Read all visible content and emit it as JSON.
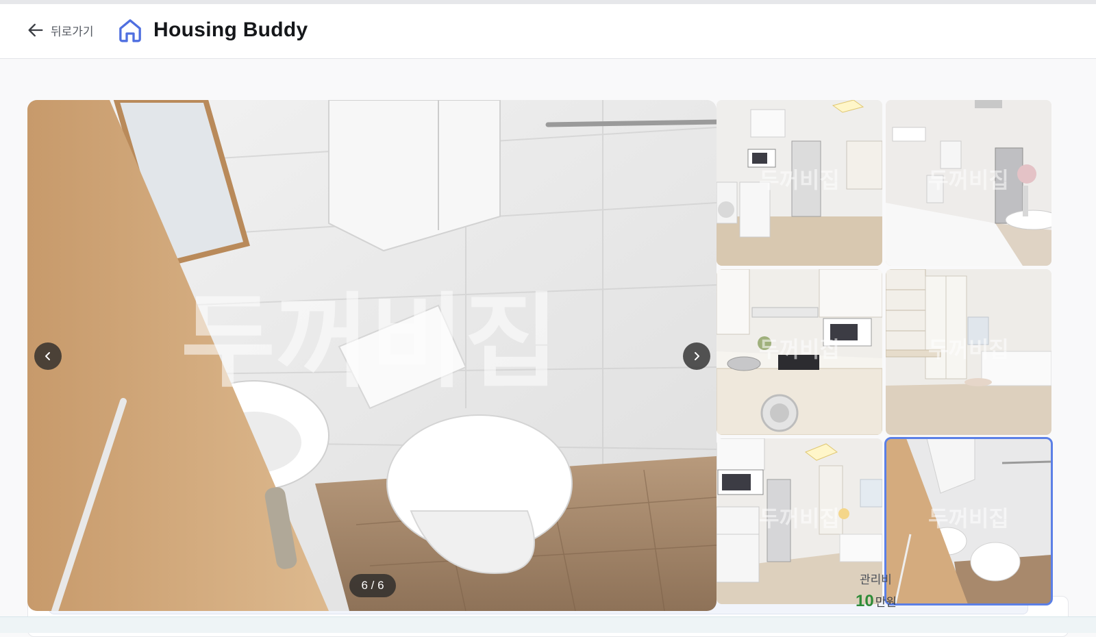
{
  "header": {
    "back_label": "뒤로가기",
    "title": "Housing Buddy",
    "brand_color": "#4f6fe0"
  },
  "gallery": {
    "counter": "6 / 6",
    "watermark": "두꺼비집",
    "current_index": 6,
    "total": 6,
    "thumbnails": [
      {
        "name": "kitchen-entrance",
        "watermark": "두꺼비집"
      },
      {
        "name": "bedroom-window",
        "watermark": "두꺼비집"
      },
      {
        "name": "kitchen-counter",
        "watermark": "두꺼비집"
      },
      {
        "name": "room-desk",
        "watermark": "두꺼비집"
      },
      {
        "name": "studio-overview",
        "watermark": "두꺼비집"
      },
      {
        "name": "bathroom",
        "watermark": "두꺼비집"
      }
    ]
  },
  "listing": {
    "fee_label": "관리비",
    "fee_amount": "10",
    "fee_unit": "만원",
    "fee_color": "#2e8b38"
  }
}
